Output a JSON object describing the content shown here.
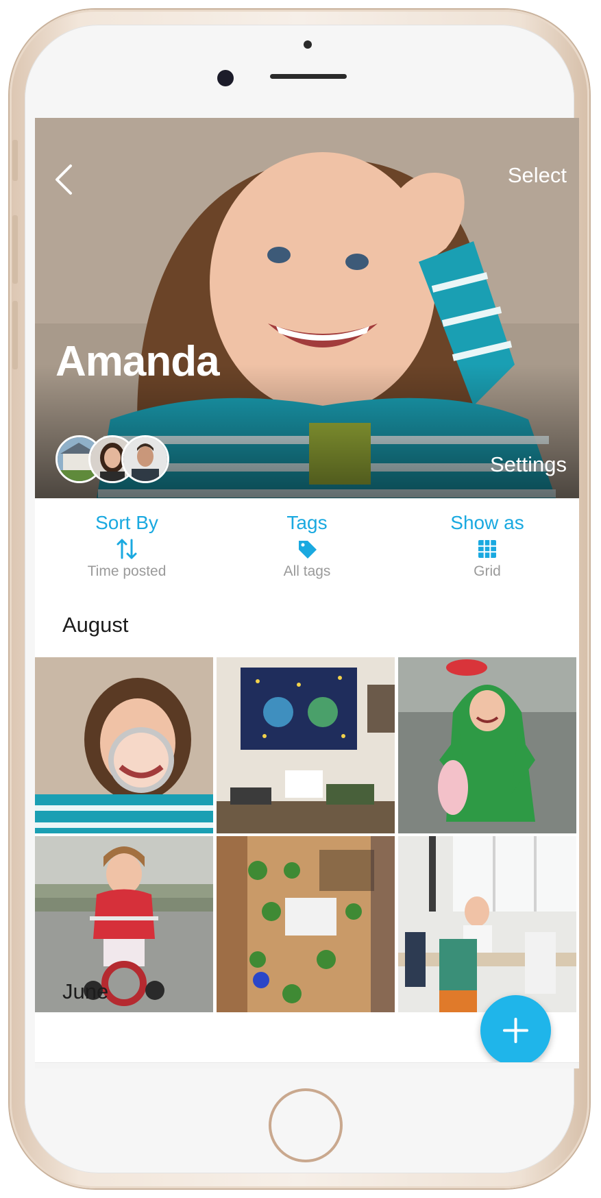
{
  "header": {
    "back_icon": "chevron-left-icon",
    "select_label": "Select",
    "profile_name": "Amanda",
    "settings_label": "Settings",
    "avatars": [
      "house-photo-avatar",
      "woman-avatar",
      "man-avatar"
    ]
  },
  "filters": [
    {
      "title": "Sort By",
      "icon": "sort-arrows-icon",
      "value": "Time posted"
    },
    {
      "title": "Tags",
      "icon": "tag-icon",
      "value": "All tags"
    },
    {
      "title": "Show as",
      "icon": "grid-icon",
      "value": "Grid"
    }
  ],
  "sections": [
    {
      "month": "August"
    },
    {
      "month": "June"
    }
  ],
  "photos": [
    "girl-with-magnifying-glass",
    "classroom-space-poster",
    "child-in-frog-raincoat",
    "girl-on-tricycle",
    "kids-planting-at-table",
    "teacher-with-children"
  ],
  "fab": {
    "icon": "plus-icon"
  },
  "colors": {
    "accent": "#1aa9e0",
    "fab": "#1fb5ea",
    "muted": "#9a9a9a"
  }
}
